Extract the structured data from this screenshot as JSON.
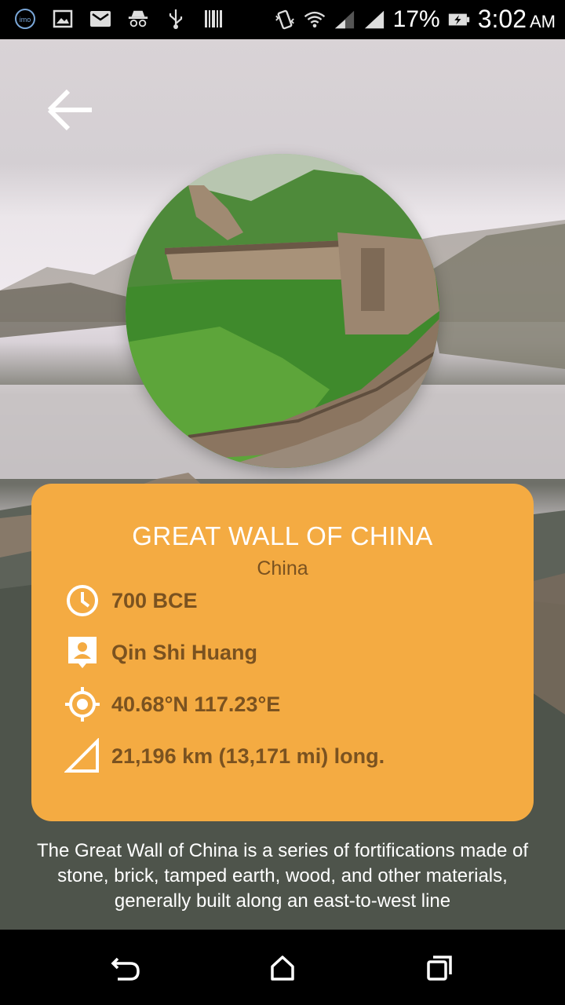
{
  "status_bar": {
    "battery_percent": "17%",
    "time": "3:02",
    "ampm": "AM",
    "left_icons": [
      "imo-icon",
      "gallery-icon",
      "mail-icon",
      "incognito-icon",
      "usb-icon",
      "barcode-icon"
    ],
    "right_icons": [
      "vibrate-icon",
      "wifi-icon",
      "signal-icon",
      "signal-icon",
      "battery-charging-icon"
    ]
  },
  "header": {
    "back_icon": "back-arrow-icon"
  },
  "landmark": {
    "name": "GREAT WALL OF CHINA",
    "country": "China",
    "details": [
      {
        "icon": "clock-icon",
        "value": "700 BCE"
      },
      {
        "icon": "person-icon",
        "value": "Qin Shi Huang"
      },
      {
        "icon": "location-target-icon",
        "value": "40.68°N 117.23°E"
      },
      {
        "icon": "length-triangle-icon",
        "value": "21,196 km (13,171 mi) long."
      }
    ],
    "description": "The Great Wall of China is a series of fortifications made of stone, brick, tamped earth, wood, and other materials, generally built along an east-to-west line"
  },
  "colors": {
    "card": "#f4ab42",
    "card_text": "#7a5220",
    "title_text": "#ffffff"
  },
  "nav_bar": {
    "back": "nav-back-icon",
    "home": "nav-home-icon",
    "recents": "nav-recents-icon"
  }
}
